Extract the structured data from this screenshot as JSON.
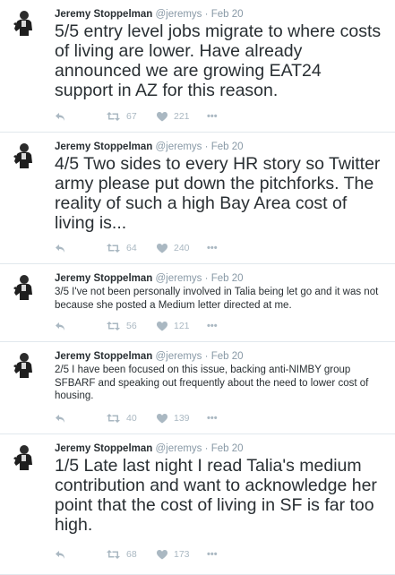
{
  "tweets": [
    {
      "name": "Jeremy Stoppelman",
      "handle": "@jeremys",
      "separator": "·",
      "date": "Feb 20",
      "text": "5/5 entry level jobs migrate to where costs of living are lower. Have already announced we are growing EAT24 support in AZ for this reason.",
      "retweets": "67",
      "likes": "221"
    },
    {
      "name": "Jeremy Stoppelman",
      "handle": "@jeremys",
      "separator": "·",
      "date": "Feb 20",
      "text": "4/5 Two sides to every HR story so Twitter army please put down the pitchforks. The reality of such a high Bay Area cost of living is...",
      "retweets": "64",
      "likes": "240"
    },
    {
      "name": "Jeremy Stoppelman",
      "handle": "@jeremys",
      "separator": "·",
      "date": "Feb 20",
      "text": "3/5 I've not been personally involved in Talia being let go and it was not because she posted a Medium letter directed at me.",
      "retweets": "56",
      "likes": "121"
    },
    {
      "name": "Jeremy Stoppelman",
      "handle": "@jeremys",
      "separator": "·",
      "date": "Feb 20",
      "text": "2/5 I have been focused on this issue, backing anti-NIMBY group SFBARF and speaking out frequently about the need to lower cost of housing.",
      "retweets": "40",
      "likes": "139"
    },
    {
      "name": "Jeremy Stoppelman",
      "handle": "@jeremys",
      "separator": "·",
      "date": "Feb 20",
      "text": "1/5 Late last night I read Talia's medium contribution and want to acknowledge her point that the cost of living in SF is far too high.",
      "retweets": "68",
      "likes": "173"
    }
  ],
  "icons": {
    "reply": "reply-icon",
    "retweet": "retweet-icon",
    "like": "heart-icon",
    "more": "more-dots-icon",
    "avatar": "profile-photo"
  },
  "colors": {
    "text": "#292f33",
    "muted": "#8899a6",
    "action": "#aab8c2",
    "divider": "#e1e8ed"
  },
  "more_label": "•••"
}
